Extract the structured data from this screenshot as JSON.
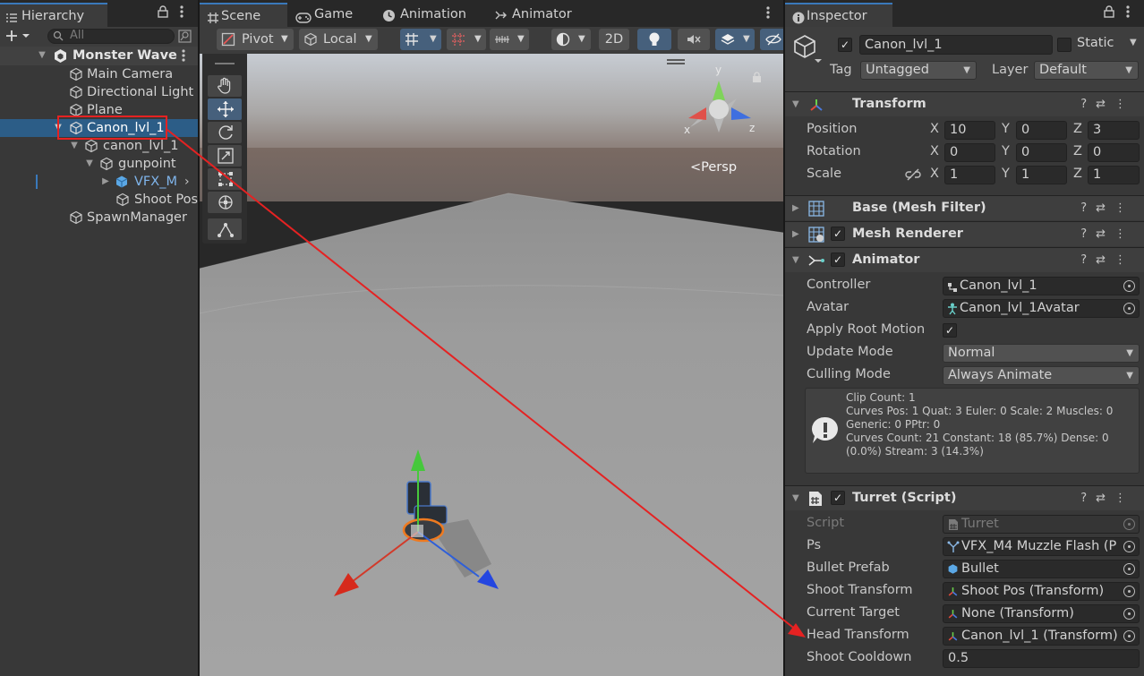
{
  "hierarchy": {
    "tab_label": "Hierarchy",
    "search_placeholder": "All",
    "scene_name": "Monster Wave",
    "items": [
      {
        "label": "Main Camera"
      },
      {
        "label": "Directional Light"
      },
      {
        "label": "Plane"
      },
      {
        "label": "Canon_lvl_1"
      },
      {
        "label": "canon_lvl_1"
      },
      {
        "label": "gunpoint"
      },
      {
        "label": "VFX_M"
      },
      {
        "label": "Shoot Pos"
      },
      {
        "label": "SpawnManager"
      }
    ]
  },
  "scene_view": {
    "tabs": [
      {
        "label": "Scene"
      },
      {
        "label": "Game"
      },
      {
        "label": "Animation"
      },
      {
        "label": "Animator"
      }
    ],
    "pivot_label": "Pivot",
    "local_label": "Local",
    "mode_2d_label": "2D",
    "gizmo_labels": {
      "y": "y",
      "x": "x",
      "z": "z"
    },
    "projection_label": "<Persp"
  },
  "inspector": {
    "tab_label": "Inspector",
    "object_name": "Canon_lvl_1",
    "static_label": "Static",
    "tag_label": "Tag",
    "tag_value": "Untagged",
    "layer_label": "Layer",
    "layer_value": "Default",
    "transform": {
      "title": "Transform",
      "position_label": "Position",
      "rotation_label": "Rotation",
      "scale_label": "Scale",
      "axis_x": "X",
      "axis_y": "Y",
      "axis_z": "Z",
      "position": {
        "x": "10",
        "y": "0",
        "z": "3"
      },
      "rotation": {
        "x": "0",
        "y": "0",
        "z": "0"
      },
      "scale": {
        "x": "1",
        "y": "1",
        "z": "1"
      }
    },
    "mesh_filter": {
      "title": "Base (Mesh Filter)"
    },
    "mesh_renderer": {
      "title": "Mesh Renderer"
    },
    "animator": {
      "title": "Animator",
      "controller_label": "Controller",
      "controller_value": "Canon_lvl_1",
      "avatar_label": "Avatar",
      "avatar_value": "Canon_lvl_1Avatar",
      "apply_root_motion_label": "Apply Root Motion",
      "update_mode_label": "Update Mode",
      "update_mode_value": "Normal",
      "culling_mode_label": "Culling Mode",
      "culling_mode_value": "Always Animate",
      "info_lines": [
        "Clip Count: 1",
        "Curves Pos: 1 Quat: 3 Euler: 0 Scale: 2 Muscles: 0",
        "Generic: 0 PPtr: 0",
        "Curves Count: 21 Constant: 18 (85.7%) Dense: 0",
        "(0.0%) Stream: 3 (14.3%)"
      ]
    },
    "turret": {
      "title": "Turret (Script)",
      "script_label": "Script",
      "script_value": "Turret",
      "ps_label": "Ps",
      "ps_value": "VFX_M4 Muzzle Flash (P",
      "bullet_prefab_label": "Bullet Prefab",
      "bullet_prefab_value": "Bullet",
      "shoot_transform_label": "Shoot Transform",
      "shoot_transform_value": "Shoot Pos (Transform)",
      "current_target_label": "Current Target",
      "current_target_value": "None (Transform)",
      "head_transform_label": "Head Transform",
      "head_transform_value": "Canon_lvl_1 (Transform)",
      "shoot_cooldown_label": "Shoot Cooldown",
      "shoot_cooldown_value": "0.5"
    }
  },
  "colors": {
    "selection": "#2c5d87",
    "accent_blue": "#3a79bb",
    "annotation_red": "#e52222"
  }
}
